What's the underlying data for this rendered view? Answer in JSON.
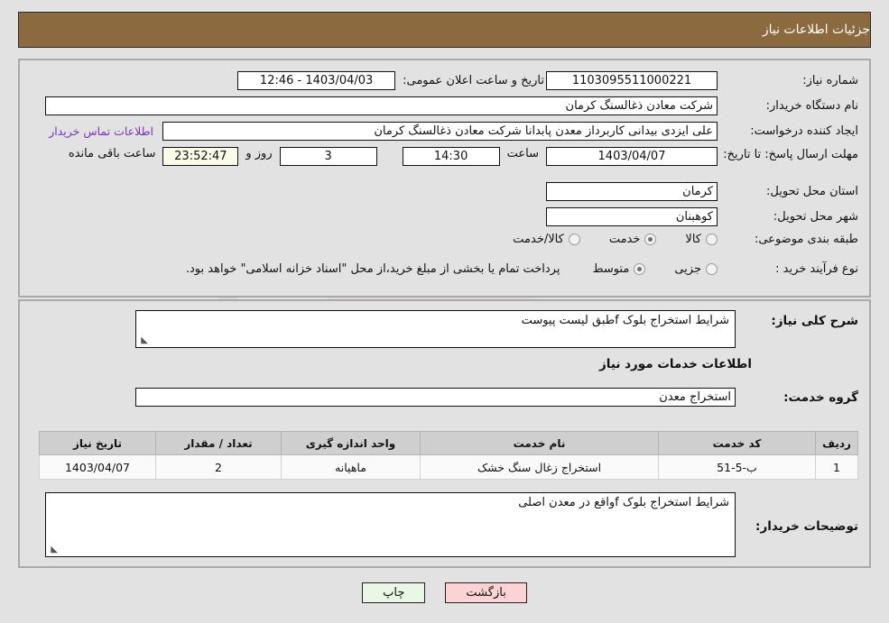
{
  "header": {
    "title": "جزئیات اطلاعات نیاز"
  },
  "colors": {
    "header_bg": "#8c6a3f",
    "page_bg": "#e2e2e2",
    "link": "#7b2fbe",
    "countdown_bg": "#fbfbe8",
    "print_btn": "#e9f7e4",
    "back_btn": "#fbd3d3"
  },
  "fields": {
    "need_number_label": "شماره نیاز:",
    "need_number_value": "1103095511000221",
    "buyer_org_label": "نام دستگاه خریدار:",
    "buyer_org_value": "شرکت معادن ذغالسنگ کرمان",
    "requester_label": "ایجاد کننده درخواست:",
    "requester_value": "علی ایزدی بیدانی کاربرداز معدن پابدانا شرکت معادن ذغالسنگ کرمان",
    "announce_label": "تاریخ و ساعت اعلان عمومی:",
    "announce_value": "1403/04/03 - 12:46",
    "buyer_org_left_value": "شرکت معادن ذغالسنگ کرمان",
    "contact_link": "اطلاعات تماس خریدار",
    "deadline_label": "مهلت ارسال پاسخ: تا تاریخ:",
    "deadline_date": "1403/04/07",
    "hour_label": "ساعت",
    "hour_value": "14:30",
    "days_value": "3",
    "days_label": "روز و",
    "countdown_value": "23:52:47",
    "remaining_label": "ساعت باقی مانده",
    "province_label": "استان محل تحویل:",
    "province_value": "کرمان",
    "city_label": "شهر محل تحویل:",
    "city_value": "کوهبنان",
    "category_label": "طبقه بندی موضوعی:",
    "process_label": "نوع فرآیند خرید :",
    "payment_note": "پرداخت تمام یا بخشی از مبلغ خرید،از محل \"اسناد خزانه اسلامی\" خواهد بود."
  },
  "category_options": [
    {
      "label": "کالا",
      "selected": false
    },
    {
      "label": "خدمت",
      "selected": true
    },
    {
      "label": "کالا/خدمت",
      "selected": false
    }
  ],
  "process_options": [
    {
      "label": "جزیی",
      "selected": false
    },
    {
      "label": "متوسط",
      "selected": true
    }
  ],
  "description": {
    "label": "شرح کلی نیاز:",
    "value": "شرایط استخراج بلوک fطبق لیست پیوست"
  },
  "services_section": {
    "heading": "اطلاعات خدمات مورد نیاز",
    "group_label": "گروه خدمت:",
    "group_value": "استخراج معدن"
  },
  "table": {
    "headers": [
      "ردیف",
      "کد خدمت",
      "نام خدمت",
      "واحد اندازه گیری",
      "تعداد / مقدار",
      "تاریخ نیاز"
    ],
    "rows": [
      {
        "row": "1",
        "code": "ب-5-51",
        "name": "استخراج زغال سنگ خشک",
        "unit": "ماهیانه",
        "qty": "2",
        "date": "1403/04/07"
      }
    ]
  },
  "buyer_notes": {
    "label": "توضیحات خریدار:",
    "value": "شرایط استخراج بلوک fواقع در معدن اصلی"
  },
  "buttons": {
    "print": "چاپ",
    "back": "بازگشت"
  },
  "watermark": {
    "text": "AriaTender.net"
  }
}
